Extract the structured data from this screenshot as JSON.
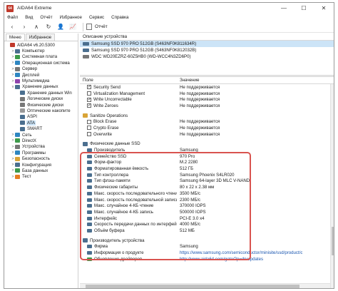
{
  "window": {
    "title": "AIDA64 Extreme",
    "app_icon_text": "64",
    "minimize": "—",
    "maximize": "☐",
    "close": "✕"
  },
  "menu": [
    "Файл",
    "Вид",
    "Отчёт",
    "Избранное",
    "Сервис",
    "Справка"
  ],
  "toolbar": {
    "back": "‹",
    "forward": "›",
    "up": "∧",
    "refresh": "↻",
    "user": "👤",
    "chart": "📈",
    "report_label": "Отчёт"
  },
  "left_panel": {
    "tabs": [
      "Меню",
      "Избранное"
    ],
    "tree": [
      {
        "label": "AIDA64 v6.20.5300",
        "indent": 0,
        "expander": "",
        "icon": "#c0392b"
      },
      {
        "label": "Компьютер",
        "indent": 1,
        "expander": ">",
        "icon": "#4b6f8f"
      },
      {
        "label": "Системная плата",
        "indent": 1,
        "expander": ">",
        "icon": "#3d9a4a"
      },
      {
        "label": "Операционная система",
        "indent": 1,
        "expander": ">",
        "icon": "#2e86c1"
      },
      {
        "label": "Сервер",
        "indent": 1,
        "expander": ">",
        "icon": "#777777"
      },
      {
        "label": "Дисплей",
        "indent": 1,
        "expander": ">",
        "icon": "#2e86c1"
      },
      {
        "label": "Мультимедиа",
        "indent": 1,
        "expander": ">",
        "icon": "#8e44ad"
      },
      {
        "label": "Хранение данных",
        "indent": 1,
        "expander": "v",
        "icon": "#4b6f8f"
      },
      {
        "label": "Хранение данных Win",
        "indent": 2,
        "expander": "",
        "icon": "#4b6f8f"
      },
      {
        "label": "Логические диски",
        "indent": 2,
        "expander": "",
        "icon": "#777777"
      },
      {
        "label": "Физические диски",
        "indent": 2,
        "expander": "",
        "icon": "#777777"
      },
      {
        "label": "Оптические накопите",
        "indent": 2,
        "expander": "",
        "icon": "#999999"
      },
      {
        "label": "ASPI",
        "indent": 2,
        "expander": "",
        "icon": "#4b6f8f"
      },
      {
        "label": "ATA",
        "indent": 2,
        "expander": "",
        "icon": "#4b6f8f",
        "selected": true
      },
      {
        "label": "SMART",
        "indent": 2,
        "expander": "",
        "icon": "#4b6f8f"
      },
      {
        "label": "Сеть",
        "indent": 1,
        "expander": ">",
        "icon": "#2e86c1"
      },
      {
        "label": "DirectX",
        "indent": 1,
        "expander": ">",
        "icon": "#3d9a4a"
      },
      {
        "label": "Устройства",
        "indent": 1,
        "expander": ">",
        "icon": "#777777"
      },
      {
        "label": "Программы",
        "indent": 1,
        "expander": ">",
        "icon": "#2e86c1"
      },
      {
        "label": "Безопасность",
        "indent": 1,
        "expander": ">",
        "icon": "#d9a437"
      },
      {
        "label": "Конфигурация",
        "indent": 1,
        "expander": ">",
        "icon": "#4b6f8f"
      },
      {
        "label": "База данных",
        "indent": 1,
        "expander": ">",
        "icon": "#3d9a4a"
      },
      {
        "label": "Тест",
        "indent": 1,
        "expander": ">",
        "icon": "#e67e22"
      }
    ]
  },
  "devices": {
    "header": "Описание устройства",
    "items": [
      {
        "label": "Samsung SSD 970 PRO 512GB (S463NF0K811634R)",
        "selected": true,
        "kind": "ssd"
      },
      {
        "label": "Samsung SSD 970 PRO 512GB (S463NF0K812032B)",
        "selected": false,
        "kind": "ssd"
      },
      {
        "label": "WDC WD20EZRZ-60Z5HB0 (WD-WCC4N3ZD6P0)",
        "selected": false,
        "kind": "hdd"
      }
    ]
  },
  "grid": {
    "col_field": "Поле",
    "col_value": "Значение",
    "rows": [
      {
        "type": "check",
        "checked": true,
        "field": "Security Send",
        "value": "Не поддерживается"
      },
      {
        "type": "check",
        "checked": false,
        "field": "Virtualization Management",
        "value": "Не поддерживается"
      },
      {
        "type": "check",
        "checked": true,
        "field": "Write Uncorrectable",
        "value": "Не поддерживается"
      },
      {
        "type": "check",
        "checked": true,
        "field": "Write Zeroes",
        "value": "Не поддерживается"
      },
      {
        "type": "blank"
      },
      {
        "type": "section",
        "field": "Sanitize Operations",
        "icon": "gold"
      },
      {
        "type": "check",
        "checked": false,
        "field": "Block Erase",
        "value": "Не поддерживается"
      },
      {
        "type": "check",
        "checked": false,
        "field": "Crypto Erase",
        "value": "Не поддерживается"
      },
      {
        "type": "check",
        "checked": false,
        "field": "Overwrite",
        "value": "Не поддерживается"
      },
      {
        "type": "blank"
      },
      {
        "type": "section",
        "field": "Физические данные SSD",
        "icon": "blue"
      },
      {
        "type": "item",
        "field": "Производитель",
        "value": "Samsung"
      },
      {
        "type": "item",
        "field": "Семейство SSD",
        "value": "970 Pro"
      },
      {
        "type": "item",
        "field": "Форм-фактор",
        "value": "M.2 2280"
      },
      {
        "type": "item",
        "field": "Форматированная ёмкость",
        "value": "512 ГБ"
      },
      {
        "type": "item",
        "field": "Тип контроллера",
        "value": "Samsung Phoenix S4LR020"
      },
      {
        "type": "item",
        "field": "Тип флэш-памяти",
        "value": "Samsung 64-layer 3D MLC V-NAND"
      },
      {
        "type": "item",
        "field": "Физические габариты",
        "value": "80 x 22 x 2.38 мм"
      },
      {
        "type": "item",
        "field": "Макс. скорость последовательного чтения",
        "value": "3500 МБ/с"
      },
      {
        "type": "item",
        "field": "Макс. скорость последовательной записи",
        "value": "2300 МБ/с"
      },
      {
        "type": "item",
        "field": "Макс. случайное 4-КБ чтение",
        "value": "370000 IOPS"
      },
      {
        "type": "item",
        "field": "Макс. случайное 4-КБ запись",
        "value": "500000 IOPS"
      },
      {
        "type": "item",
        "field": "Интерфейс",
        "value": "PCI-E 3.0 x4"
      },
      {
        "type": "item",
        "field": "Скорость передачи данных по интерфейсу",
        "value": "4000 МБ/с"
      },
      {
        "type": "item",
        "field": "Объём буфера",
        "value": "512 МБ"
      },
      {
        "type": "blank"
      },
      {
        "type": "section",
        "field": "Производитель устройства",
        "icon": "blue"
      },
      {
        "type": "item",
        "field": "Фирма",
        "value": "Samsung"
      },
      {
        "type": "item",
        "field": "Информация о продукте",
        "value": "https://www.samsung.com/semiconductor/minisite/ssd/product/c",
        "link": true
      },
      {
        "type": "item",
        "field": "Обновление драйверов",
        "value": "http://www.aida64.com/goto/?p=drvupdates",
        "link": true,
        "icon": "green"
      }
    ]
  }
}
